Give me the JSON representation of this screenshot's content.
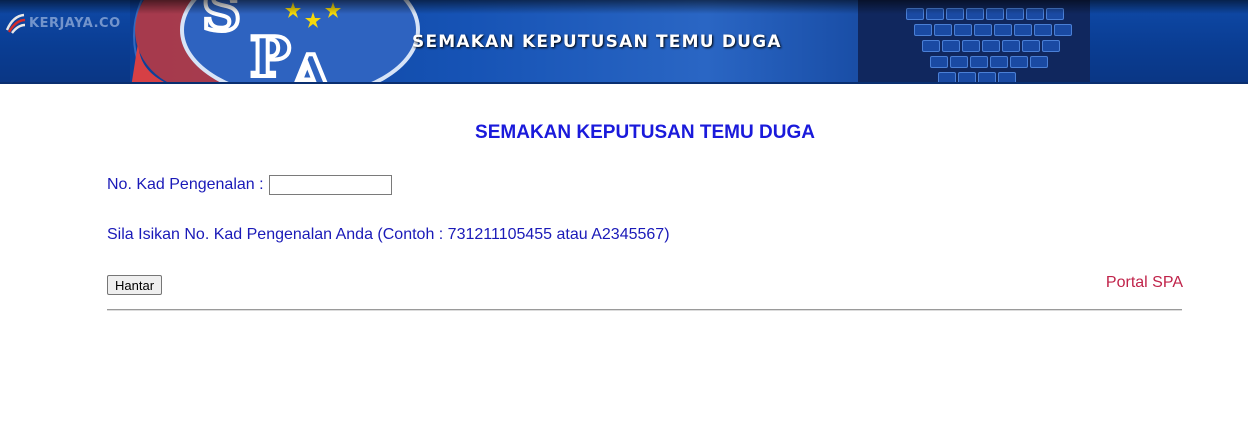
{
  "banner": {
    "title": "SEMAKAN KEPUTUSAN TEMU DUGA",
    "watermark": "KERJAYA.CO",
    "logo": "SPA",
    "icons": [
      "kerjaya-logo-icon",
      "spa-logo-icon",
      "keyboard-icon"
    ]
  },
  "main": {
    "title": "SEMAKAN KEPUTUSAN TEMU DUGA",
    "ic_label": "No. Kad Pengenalan :",
    "ic_value": "",
    "hint": "Sila Isikan No. Kad Pengenalan Anda (Contoh : 731211105455 atau A2345567)",
    "submit_label": "Hantar",
    "portal_link": "Portal SPA"
  },
  "colors": {
    "banner_blue": "#0a3d93",
    "text_blue": "#1a1ab8",
    "title_blue": "#1a1adb",
    "link_red": "#c0234a"
  }
}
